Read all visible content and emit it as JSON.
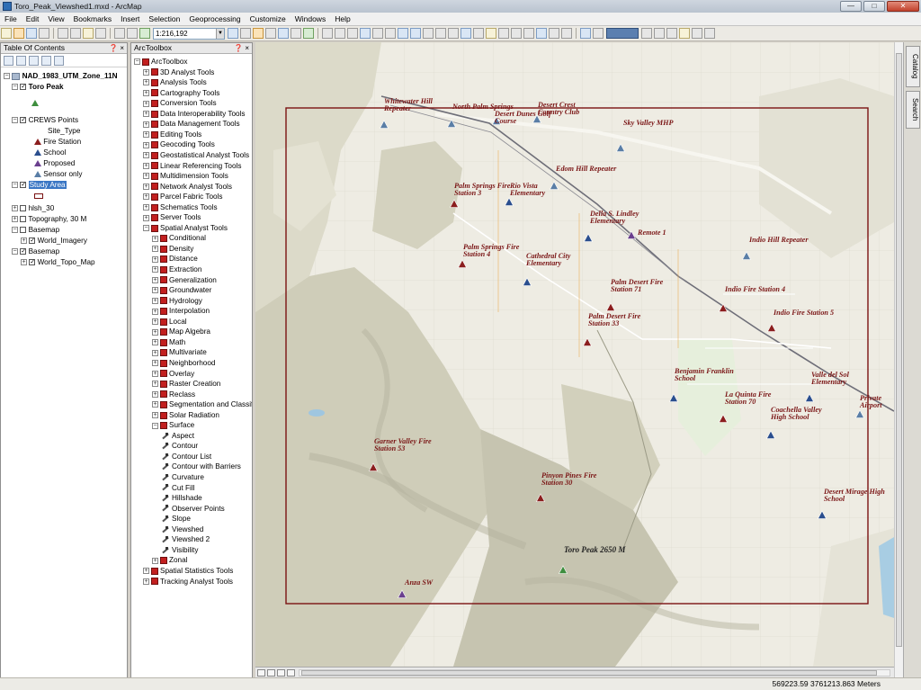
{
  "window": {
    "title": "Toro_Peak_Viewshed1.mxd - ArcMap",
    "min_glyph": "—",
    "max_glyph": "□",
    "close_glyph": "✕"
  },
  "menu": [
    "File",
    "Edit",
    "View",
    "Bookmarks",
    "Insert",
    "Selection",
    "Geoprocessing",
    "Customize",
    "Windows",
    "Help"
  ],
  "toolbar": {
    "scale": "1:216,192"
  },
  "toc": {
    "title": "Table Of Contents",
    "head_controls": "❓ ×",
    "layers": [
      {
        "label": "NAD_1983_UTM_Zone_11N"
      },
      {
        "label": "Toro Peak"
      },
      {
        "label": "CREWS Points"
      },
      {
        "label": "Site_Type"
      },
      {
        "label": "Fire Station"
      },
      {
        "label": "School"
      },
      {
        "label": "Proposed"
      },
      {
        "label": "Sensor only"
      },
      {
        "label": "Study Area"
      },
      {
        "label": "hlsh_30"
      },
      {
        "label": "Topography, 30 M"
      },
      {
        "label": "Basemap"
      },
      {
        "label": "World_Imagery"
      },
      {
        "label": "Basemap"
      },
      {
        "label": "World_Topo_Map"
      }
    ]
  },
  "arctoolbox": {
    "title": "ArcToolbox",
    "head_controls": "❓ ×",
    "items": [
      {
        "label": "ArcToolbox"
      },
      {
        "label": "3D Analyst Tools"
      },
      {
        "label": "Analysis Tools"
      },
      {
        "label": "Cartography Tools"
      },
      {
        "label": "Conversion Tools"
      },
      {
        "label": "Data Interoperability Tools"
      },
      {
        "label": "Data Management Tools"
      },
      {
        "label": "Editing Tools"
      },
      {
        "label": "Geocoding Tools"
      },
      {
        "label": "Geostatistical Analyst Tools"
      },
      {
        "label": "Linear Referencing Tools"
      },
      {
        "label": "Multidimension Tools"
      },
      {
        "label": "Network Analyst Tools"
      },
      {
        "label": "Parcel Fabric Tools"
      },
      {
        "label": "Schematics Tools"
      },
      {
        "label": "Server Tools"
      },
      {
        "label": "Spatial Analyst Tools"
      },
      {
        "label": "Conditional"
      },
      {
        "label": "Density"
      },
      {
        "label": "Distance"
      },
      {
        "label": "Extraction"
      },
      {
        "label": "Generalization"
      },
      {
        "label": "Groundwater"
      },
      {
        "label": "Hydrology"
      },
      {
        "label": "Interpolation"
      },
      {
        "label": "Local"
      },
      {
        "label": "Map Algebra"
      },
      {
        "label": "Math"
      },
      {
        "label": "Multivariate"
      },
      {
        "label": "Neighborhood"
      },
      {
        "label": "Overlay"
      },
      {
        "label": "Raster Creation"
      },
      {
        "label": "Reclass"
      },
      {
        "label": "Segmentation and Classification"
      },
      {
        "label": "Solar Radiation"
      },
      {
        "label": "Surface"
      },
      {
        "label": "Aspect"
      },
      {
        "label": "Contour"
      },
      {
        "label": "Contour List"
      },
      {
        "label": "Contour with Barriers"
      },
      {
        "label": "Curvature"
      },
      {
        "label": "Cut Fill"
      },
      {
        "label": "Hillshade"
      },
      {
        "label": "Observer Points"
      },
      {
        "label": "Slope"
      },
      {
        "label": "Viewshed"
      },
      {
        "label": "Viewshed 2"
      },
      {
        "label": "Visibility"
      },
      {
        "label": "Zonal"
      },
      {
        "label": "Spatial Statistics Tools"
      },
      {
        "label": "Tracking Analyst Tools"
      }
    ]
  },
  "map": {
    "labels": [
      {
        "text": "Whitewater Hill Repeater"
      },
      {
        "text": "North Palm Springs"
      },
      {
        "text": "Desert Dunes Golf Course"
      },
      {
        "text": "Desert Crest Country Club"
      },
      {
        "text": "Sky Valley MHP"
      },
      {
        "text": "Edom Hill Repeater"
      },
      {
        "text": "Palm Springs Fire Station 3"
      },
      {
        "text": "Rio Vista Elementary"
      },
      {
        "text": "Della S. Lindley Elementary"
      },
      {
        "text": "Remote 1"
      },
      {
        "text": "Indio Hill Repeater"
      },
      {
        "text": "Palm Springs Fire Station 4"
      },
      {
        "text": "Cathedral City Elementary"
      },
      {
        "text": "Palm Desert Fire Station 71"
      },
      {
        "text": "Indio Fire Station 4"
      },
      {
        "text": "Palm Desert Fire Station 33"
      },
      {
        "text": "Indio Fire Station 5"
      },
      {
        "text": "Benjamin Franklin School"
      },
      {
        "text": "Valle del Sol Elementary"
      },
      {
        "text": "La Quinta Fire Station 70"
      },
      {
        "text": "Coachella Valley High School"
      },
      {
        "text": "Private Airport"
      },
      {
        "text": "Garner Valley Fire Station 53"
      },
      {
        "text": "Pinyon Pines Fire Station 30"
      },
      {
        "text": "Desert Mirage High School"
      },
      {
        "text": "Toro Peak 2650 M"
      },
      {
        "text": "Anza SW"
      }
    ],
    "colors": {
      "fire_station": "#8b1e1e",
      "school": "#2a4e8e",
      "sensor_only": "#5a7ea6",
      "proposed": "#6a3f8e",
      "toro_peak": "#3e8e3e",
      "study_area": "#7a1212"
    }
  },
  "side_tabs": [
    "Catalog",
    "Search"
  ],
  "status": {
    "coords": "569223.59  3761213.863 Meters"
  }
}
